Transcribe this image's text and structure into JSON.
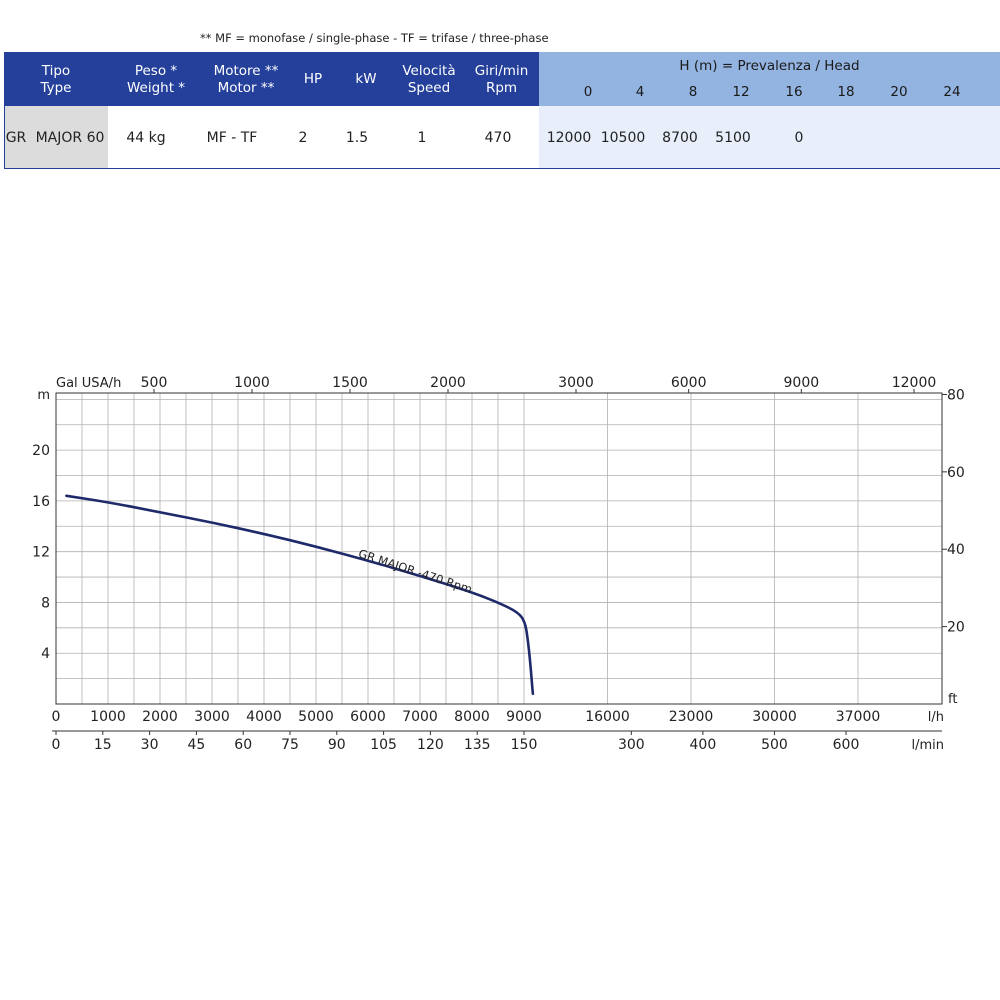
{
  "note": "** MF =  monofase / single-phase - TF =  trifase / three-phase",
  "table": {
    "headers": [
      {
        "l1": "Tipo",
        "l2": "Type"
      },
      {
        "l1": "Peso *",
        "l2": "Weight *"
      },
      {
        "l1": "Motore **",
        "l2": "Motor **"
      },
      {
        "l1": "HP",
        "l2": ""
      },
      {
        "l1": "kW",
        "l2": ""
      },
      {
        "l1": "Velocità",
        "l2": "Speed"
      },
      {
        "l1": "Giri/min",
        "l2": "Rpm"
      }
    ],
    "head_title": "H (m) =  Prevalenza / Head",
    "head_values": [
      "0",
      "4",
      "8",
      "12",
      "16",
      "18",
      "20",
      "24"
    ],
    "row": {
      "prefix": "GR",
      "type": "MAJOR 60",
      "weight": "44 kg",
      "motor": "MF - TF",
      "hp": "2",
      "kw": "1.5",
      "speed": "1",
      "rpm": "470",
      "flows": [
        "12000",
        "10500",
        "8700",
        "5100",
        "0"
      ]
    }
  },
  "chart_data": {
    "type": "line",
    "series": [
      {
        "name": "GR MAJOR  -470 Rpm",
        "x_lh": [
          200,
          1000,
          2000,
          3000,
          4000,
          5000,
          6000,
          7000,
          8000,
          8500,
          8900,
          9100,
          9300,
          9500,
          9650,
          9750
        ],
        "y_m": [
          16.4,
          15.9,
          15.1,
          14.3,
          13.4,
          12.4,
          11.3,
          10.1,
          8.8,
          8.0,
          7.2,
          6.4,
          5.2,
          3.5,
          1.8,
          0.8
        ]
      }
    ],
    "x_axis_bottom_lh": {
      "unit": "l/h",
      "ticks": [
        "0",
        "1000",
        "2000",
        "3000",
        "4000",
        "5000",
        "6000",
        "7000",
        "8000",
        "9000",
        "16000",
        "23000",
        "30000",
        "37000"
      ]
    },
    "x_axis_bottom_lmin": {
      "unit": "l/min",
      "ticks": [
        "0",
        "15",
        "30",
        "45",
        "60",
        "75",
        "90",
        "105",
        "120",
        "135",
        "150",
        "300",
        "400",
        "500",
        "600"
      ]
    },
    "x_axis_top_gal": {
      "unit": "Gal USA/h",
      "ticks": [
        "500",
        "1000",
        "1500",
        "2000",
        "3000",
        "6000",
        "9000",
        "12000"
      ]
    },
    "y_axis_left": {
      "unit": "m",
      "ticks": [
        "4",
        "8",
        "12",
        "16",
        "20"
      ],
      "ylim": [
        0,
        24.5
      ]
    },
    "y_axis_right": {
      "unit": "ft",
      "ticks": [
        "20",
        "40",
        "60",
        "80"
      ]
    },
    "grid": true,
    "colors": {
      "curve": "#1f2a6b",
      "grid": "#b0b0b0",
      "axis": "#333333"
    }
  }
}
